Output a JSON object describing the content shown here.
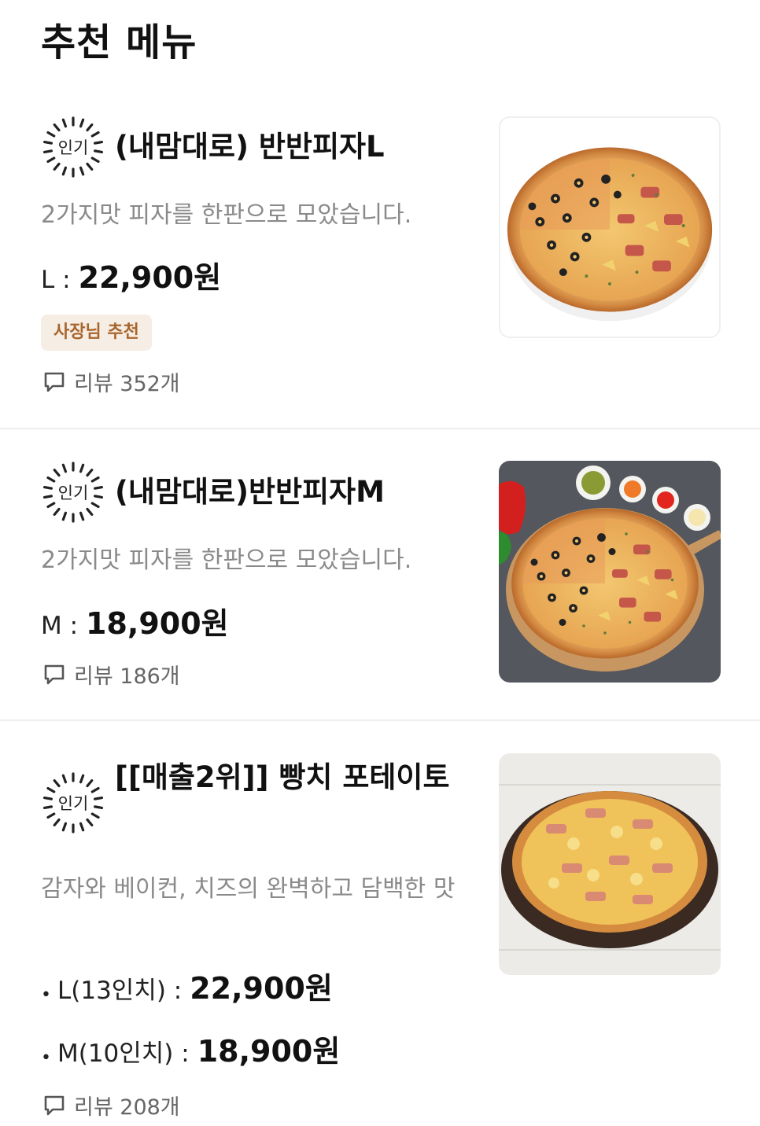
{
  "section": {
    "title": "추천 메뉴"
  },
  "badge_text": "인기",
  "items": [
    {
      "name": "(내맘대로) 반반피자L",
      "description": "2가지맛 피자를 한판으로 모았습니다.",
      "prices": [
        {
          "label": "L :",
          "value": "22,900원"
        }
      ],
      "owner_badge": "사장님 추천",
      "review": "리뷰 352개",
      "image_icon": "half-and-half-pizza-image"
    },
    {
      "name": "(내맘대로)반반피자M",
      "description": "2가지맛 피자를 한판으로 모았습니다.",
      "prices": [
        {
          "label": "M :",
          "value": "18,900원"
        }
      ],
      "review": "리뷰 186개",
      "image_icon": "pizza-with-sauces-image"
    },
    {
      "name": "[[매출2위]] 빵치 포테이토",
      "description": "감자와 베이컨, 치즈의 완벽하고 담백한 맛",
      "prices": [
        {
          "label": "L(13인치) :",
          "value": "22,900원"
        },
        {
          "label": "M(10인치) :",
          "value": "18,900원"
        }
      ],
      "review": "리뷰 208개",
      "image_icon": "potato-pizza-image"
    }
  ],
  "colors": {
    "owner_badge_bg": "#f6ede4",
    "owner_badge_text": "#a8662e",
    "description_text": "#8a8a8a",
    "divider": "#eeeeee"
  }
}
